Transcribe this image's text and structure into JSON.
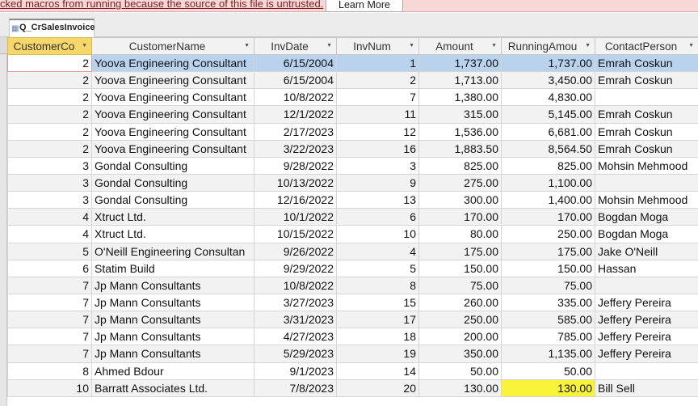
{
  "security_bar": {
    "message": "cked macros from running because the source of this file is untrusted.",
    "button_label": "Learn More"
  },
  "tab": {
    "label": "Q_CrSalesInvoice"
  },
  "columns": [
    "CustomerCo",
    "CustomerName",
    "InvDate",
    "InvNum",
    "Amount",
    "RunningAmou",
    "ContactPerson"
  ],
  "rows": [
    {
      "customer_code": "2",
      "customer_name": "Yoova Engineering Consultant",
      "inv_date": "6/15/2004",
      "inv_num": "1",
      "amount": "1,737.00",
      "running_amount": "1,737.00",
      "contact": "Emrah Coskun"
    },
    {
      "customer_code": "2",
      "customer_name": "Yoova Engineering Consultant",
      "inv_date": "6/15/2004",
      "inv_num": "2",
      "amount": "1,713.00",
      "running_amount": "3,450.00",
      "contact": "Emrah Coskun"
    },
    {
      "customer_code": "2",
      "customer_name": "Yoova Engineering Consultant",
      "inv_date": "10/8/2022",
      "inv_num": "7",
      "amount": "1,380.00",
      "running_amount": "4,830.00",
      "contact": ""
    },
    {
      "customer_code": "2",
      "customer_name": "Yoova Engineering Consultant",
      "inv_date": "12/1/2022",
      "inv_num": "11",
      "amount": "315.00",
      "running_amount": "5,145.00",
      "contact": "Emrah Coskun"
    },
    {
      "customer_code": "2",
      "customer_name": "Yoova Engineering Consultant",
      "inv_date": "2/17/2023",
      "inv_num": "12",
      "amount": "1,536.00",
      "running_amount": "6,681.00",
      "contact": "Emrah Coskun"
    },
    {
      "customer_code": "2",
      "customer_name": "Yoova Engineering Consultant",
      "inv_date": "3/22/2023",
      "inv_num": "16",
      "amount": "1,883.50",
      "running_amount": "8,564.50",
      "contact": "Emrah Coskun"
    },
    {
      "customer_code": "3",
      "customer_name": "Gondal Consulting",
      "inv_date": "9/28/2022",
      "inv_num": "3",
      "amount": "825.00",
      "running_amount": "825.00",
      "contact": "Mohsin Mehmood"
    },
    {
      "customer_code": "3",
      "customer_name": "Gondal Consulting",
      "inv_date": "10/13/2022",
      "inv_num": "9",
      "amount": "275.00",
      "running_amount": "1,100.00",
      "contact": ""
    },
    {
      "customer_code": "3",
      "customer_name": "Gondal Consulting",
      "inv_date": "12/16/2022",
      "inv_num": "13",
      "amount": "300.00",
      "running_amount": "1,400.00",
      "contact": "Mohsin Mehmood"
    },
    {
      "customer_code": "4",
      "customer_name": "Xtruct Ltd.",
      "inv_date": "10/1/2022",
      "inv_num": "6",
      "amount": "170.00",
      "running_amount": "170.00",
      "contact": "Bogdan Moga"
    },
    {
      "customer_code": "4",
      "customer_name": "Xtruct Ltd.",
      "inv_date": "10/15/2022",
      "inv_num": "10",
      "amount": "80.00",
      "running_amount": "250.00",
      "contact": "Bogdan Moga"
    },
    {
      "customer_code": "5",
      "customer_name": "O'Neill Engineering Consultan",
      "inv_date": "9/26/2022",
      "inv_num": "4",
      "amount": "175.00",
      "running_amount": "175.00",
      "contact": "Jake O'Neill"
    },
    {
      "customer_code": "6",
      "customer_name": "Statim Build",
      "inv_date": "9/29/2022",
      "inv_num": "5",
      "amount": "150.00",
      "running_amount": "150.00",
      "contact": "Hassan"
    },
    {
      "customer_code": "7",
      "customer_name": "Jp Mann Consultants",
      "inv_date": "10/8/2022",
      "inv_num": "8",
      "amount": "75.00",
      "running_amount": "75.00",
      "contact": ""
    },
    {
      "customer_code": "7",
      "customer_name": "Jp Mann Consultants",
      "inv_date": "3/27/2023",
      "inv_num": "15",
      "amount": "260.00",
      "running_amount": "335.00",
      "contact": "Jeffery Pereira"
    },
    {
      "customer_code": "7",
      "customer_name": "Jp Mann Consultants",
      "inv_date": "3/31/2023",
      "inv_num": "17",
      "amount": "250.00",
      "running_amount": "585.00",
      "contact": "Jeffery Pereira"
    },
    {
      "customer_code": "7",
      "customer_name": "Jp Mann Consultants",
      "inv_date": "4/27/2023",
      "inv_num": "18",
      "amount": "200.00",
      "running_amount": "785.00",
      "contact": "Jeffery Pereira"
    },
    {
      "customer_code": "7",
      "customer_name": "Jp Mann Consultants",
      "inv_date": "5/29/2023",
      "inv_num": "19",
      "amount": "350.00",
      "running_amount": "1,135.00",
      "contact": "Jeffery Pereira"
    },
    {
      "customer_code": "8",
      "customer_name": "Ahmed Bdour",
      "inv_date": "9/1/2023",
      "inv_num": "14",
      "amount": "50.00",
      "running_amount": "50.00",
      "contact": ""
    },
    {
      "customer_code": "10",
      "customer_name": "Barratt Associates Ltd.",
      "inv_date": "7/8/2023",
      "inv_num": "20",
      "amount": "130.00",
      "running_amount": "130.00",
      "contact": "Bill Sell"
    }
  ],
  "colors": {
    "selected_row": "#b9d3ee",
    "sorted_header": "#f5d76a",
    "highlight": "#f9f43a",
    "security_bar": "#f8d7d7"
  },
  "selected_row_index": 0,
  "highlighted_cell": {
    "row": 19,
    "column": "running_amount"
  }
}
